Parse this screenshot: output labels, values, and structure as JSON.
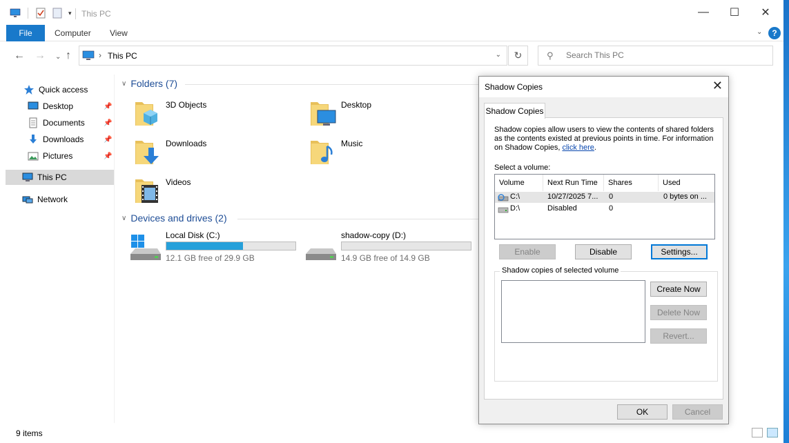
{
  "window": {
    "title": "This PC",
    "controls": {
      "minimize": "—",
      "maximize": "☐",
      "close": "✕"
    }
  },
  "ribbon": {
    "tabs": [
      {
        "label": "File"
      },
      {
        "label": "Computer"
      },
      {
        "label": "View"
      }
    ],
    "help": "?"
  },
  "address": {
    "path": "This PC",
    "search_placeholder": "Search This PC"
  },
  "nav_pane": {
    "items": [
      {
        "label": "Quick access",
        "icon": "star-icon"
      },
      {
        "label": "Desktop",
        "icon": "desktop-icon",
        "pinned": true
      },
      {
        "label": "Documents",
        "icon": "documents-icon",
        "pinned": true
      },
      {
        "label": "Downloads",
        "icon": "download-icon",
        "pinned": true
      },
      {
        "label": "Pictures",
        "icon": "pictures-icon",
        "pinned": true
      },
      {
        "label": "This PC",
        "icon": "computer-icon",
        "selected": true
      },
      {
        "label": "Network",
        "icon": "network-icon"
      }
    ]
  },
  "content": {
    "folders_header": "Folders (7)",
    "folders": [
      {
        "label": "3D Objects",
        "icon": "3d-objects-folder-icon"
      },
      {
        "label": "Desktop",
        "icon": "desktop-folder-icon"
      },
      {
        "label": "Downloads",
        "icon": "downloads-folder-icon"
      },
      {
        "label": "Music",
        "icon": "music-folder-icon"
      },
      {
        "label": "Videos",
        "icon": "videos-folder-icon"
      }
    ],
    "drives_header": "Devices and drives (2)",
    "drives": [
      {
        "label": "Local Disk (C:)",
        "free_text": "12.1 GB free of 29.9 GB",
        "used_fraction": 0.595
      },
      {
        "label": "shadow-copy (D:)",
        "free_text": "14.9 GB free of 14.9 GB",
        "used_fraction": 0.0
      }
    ]
  },
  "status_bar": {
    "items": "9 items"
  },
  "dialog": {
    "title": "Shadow Copies",
    "tab": "Shadow Copies",
    "description": "Shadow copies allow users to view the contents of shared folders as the contents existed at previous points in time. For information on Shadow Copies, ",
    "link": "click here",
    "link_suffix": ".",
    "select_volume_label": "Select a volume:",
    "table": {
      "headers": [
        "Volume",
        "Next Run Time",
        "Shares",
        "Used"
      ],
      "rows": [
        {
          "volume": "C:\\",
          "next_run": "10/27/2025 7...",
          "shares": "0",
          "used": "0 bytes on ...",
          "selected": true
        },
        {
          "volume": "D:\\",
          "next_run": "Disabled",
          "shares": "0",
          "used": ""
        }
      ]
    },
    "buttons": {
      "enable": "Enable",
      "disable": "Disable",
      "settings": "Settings...",
      "create_now": "Create Now",
      "delete_now": "Delete Now",
      "revert": "Revert...",
      "ok": "OK",
      "cancel": "Cancel"
    },
    "copies_group_label": "Shadow copies of selected volume"
  }
}
